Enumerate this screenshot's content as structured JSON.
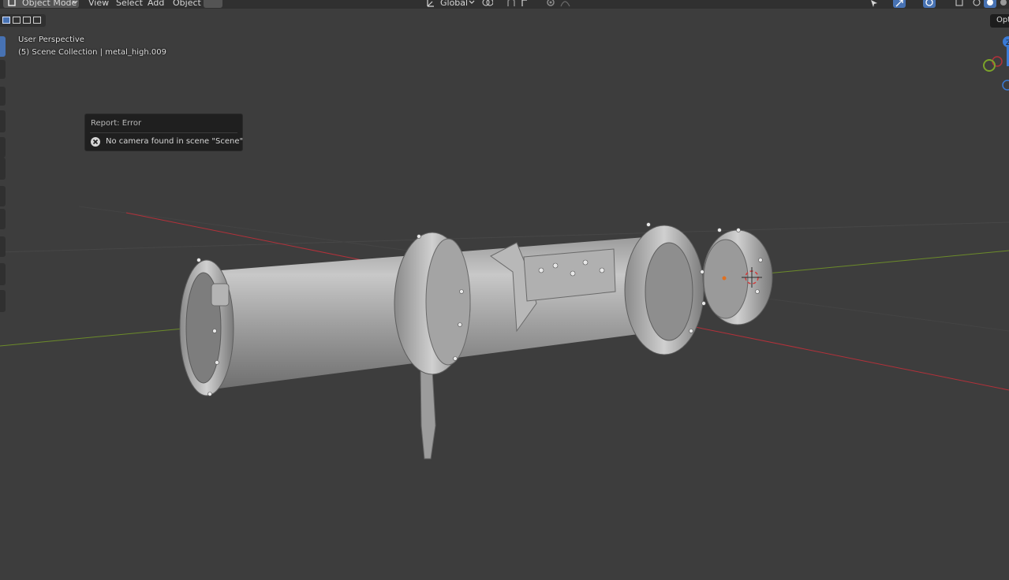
{
  "header": {
    "mode_label": "Object Mode",
    "menu": [
      "View",
      "Select",
      "Add",
      "Object"
    ],
    "orientation_label": "Global"
  },
  "viewport": {
    "perspective_label": "User Perspective",
    "collection_label": "(5) Scene Collection | metal_high.009",
    "options_label": "Opt",
    "gizmo_axis_label": "Z"
  },
  "report": {
    "title": "Report: Error",
    "message": "No camera found in scene \"Scene\""
  },
  "colors": {
    "background": "#3d3d3d",
    "header": "#303030",
    "accent": "#4772b3",
    "x_axis": "#b3313a",
    "y_axis": "#6c8b2a",
    "z_axis": "#3a7ad6",
    "object": "#a8a8a8"
  },
  "icons": [
    "object-mode-icon",
    "chevron-down-icon",
    "transform-orientation-icon",
    "pivot-icon",
    "snap-icon",
    "proportional-editing-icon",
    "visibility-icon",
    "gizmo-icon",
    "overlay-icon",
    "xray-icon",
    "shading-solid-icon",
    "error-icon",
    "3d-cursor-icon"
  ]
}
